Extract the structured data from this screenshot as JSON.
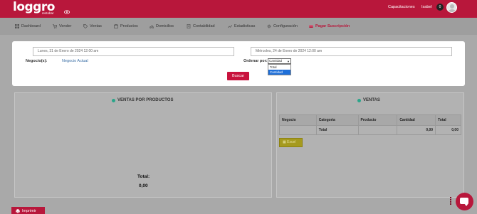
{
  "header": {
    "logo_text": "loggro",
    "logo_subtitle": "restobar",
    "capacitaciones": "Capacitaciones",
    "user_name": "Isabel",
    "notifications_count": "0"
  },
  "menu": [
    {
      "label": "Dashboard",
      "icon": "dashboard-icon"
    },
    {
      "label": "Vender",
      "icon": "cart-icon"
    },
    {
      "label": "Ventas",
      "icon": "tag-icon"
    },
    {
      "label": "Productos",
      "icon": "box-icon"
    },
    {
      "label": "Domicilios",
      "icon": "delivery-icon"
    },
    {
      "label": "Contabilidad",
      "icon": "ledger-icon"
    },
    {
      "label": "Estadisticas",
      "icon": "chart-icon"
    },
    {
      "label": "Configuración",
      "icon": "gear-icon"
    },
    {
      "label": "Pagar Suscripción",
      "icon": "card-icon"
    }
  ],
  "filters": {
    "date_from": "Lunes, 31 de Enero de 2024 12:00 am",
    "date_to": "Miércoles, 24 de Enero de 2024 12:00 am",
    "negocios_label": "Negocio(s):",
    "negocio_value": "Negocio Actual",
    "ordenar_label": "Ordenar por:",
    "ordenar_selected": "Cantidad",
    "ordenar_options": [
      "Total",
      "Cantidad"
    ],
    "buscar_label": "Buscar"
  },
  "left_card": {
    "title": "VENTAS POR PRODUCTOS",
    "total_label": "Total:",
    "total_value": "0,00"
  },
  "right_card": {
    "title": "VENTAS",
    "columns": [
      "Negocio",
      "Categoria",
      "Producto",
      "Cantidad",
      "Total"
    ],
    "total_row": {
      "label": "Total",
      "cantidad": "0,00",
      "total": "0,00"
    },
    "excel_label": "Excel"
  },
  "footer": {
    "imprimir_label": "Imprimir"
  },
  "colors": {
    "brand": "#b8173b",
    "accent_dot": "#2aa58a"
  }
}
